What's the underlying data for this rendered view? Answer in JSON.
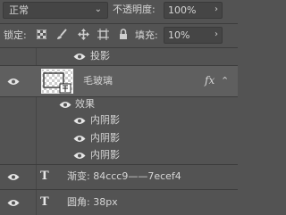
{
  "blend_mode": {
    "value": "正常"
  },
  "opacity": {
    "label": "不透明度:",
    "value": "100%"
  },
  "lock": {
    "label": "锁定:"
  },
  "fill": {
    "label": "填充:",
    "value": "10%"
  },
  "layers": {
    "drop_shadow_label": "投影",
    "glass_layer_name": "毛玻璃",
    "fx_label": "fx",
    "effects_label": "效果",
    "inner_shadow_labels": [
      "内阴影",
      "内阴影",
      "内阴影"
    ],
    "gradient_text_layer_name": "渐变: 84ccc9——7ecef4",
    "corner_text_layer_name": "圆角: 38px",
    "text_layer_glyph": "T"
  },
  "icons": {
    "blend_chevron": "chevron-down-icon",
    "opacity_chevron": "chevron-right-icon",
    "fill_chevron": "chevron-right-icon",
    "lock_pixels": "checkerboard-icon",
    "lock_paint": "brush-icon",
    "lock_move": "move-icon",
    "lock_artboard": "artboard-icon",
    "lock_all": "lock-icon",
    "layer_eye": "eye-icon",
    "fx_expand": "chevron-up-icon"
  },
  "colors": {
    "panel_bg": "#535353",
    "control_bg": "#454545",
    "selected_row": "#5f5f5f"
  }
}
